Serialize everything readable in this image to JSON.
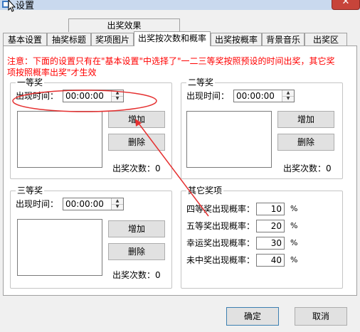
{
  "window": {
    "title": "设置",
    "close_label": "✕"
  },
  "tabs_row1": [
    {
      "label": "出奖效果"
    }
  ],
  "tabs_row2": [
    {
      "label": "基本设置"
    },
    {
      "label": "抽奖标题"
    },
    {
      "label": "奖项图片"
    },
    {
      "label": "出奖按次数和概率",
      "active": true
    },
    {
      "label": "出奖按概率"
    },
    {
      "label": "背景音乐"
    },
    {
      "label": "出奖区"
    }
  ],
  "notice": "注意：下面的设置只有在\"基本设置\"中选择了\"一二三等奖按照预设的时间出奖，其它奖项按照概率出奖\"才生效",
  "prize1": {
    "title": "一等奖",
    "time_label": "出现时间：",
    "time_value": "00:00:00",
    "add_label": "增加",
    "delete_label": "删除",
    "count_text": "出奖次数：0"
  },
  "prize2": {
    "title": "二等奖",
    "time_label": "出现时间：",
    "time_value": "00:00:00",
    "add_label": "增加",
    "delete_label": "删除",
    "count_text": "出奖次数：0"
  },
  "prize3": {
    "title": "三等奖",
    "time_label": "出现时间：",
    "time_value": "00:00:00",
    "add_label": "增加",
    "delete_label": "删除",
    "count_text": "出奖次数：0"
  },
  "others": {
    "title": "其它奖项",
    "rates": [
      {
        "label": "四等奖出现概率：",
        "value": "10",
        "unit": "%"
      },
      {
        "label": "五等奖出现概率：",
        "value": "20",
        "unit": "%"
      },
      {
        "label": "幸运奖出现概率：",
        "value": "30",
        "unit": "%"
      },
      {
        "label": "未中奖出现概率：",
        "value": "40",
        "unit": "%"
      }
    ]
  },
  "footer": {
    "ok_label": "确定",
    "cancel_label": "取消"
  },
  "colors": {
    "notice": "#ff0000",
    "annotation": "#e53030",
    "tab_active": "#ffffff"
  }
}
